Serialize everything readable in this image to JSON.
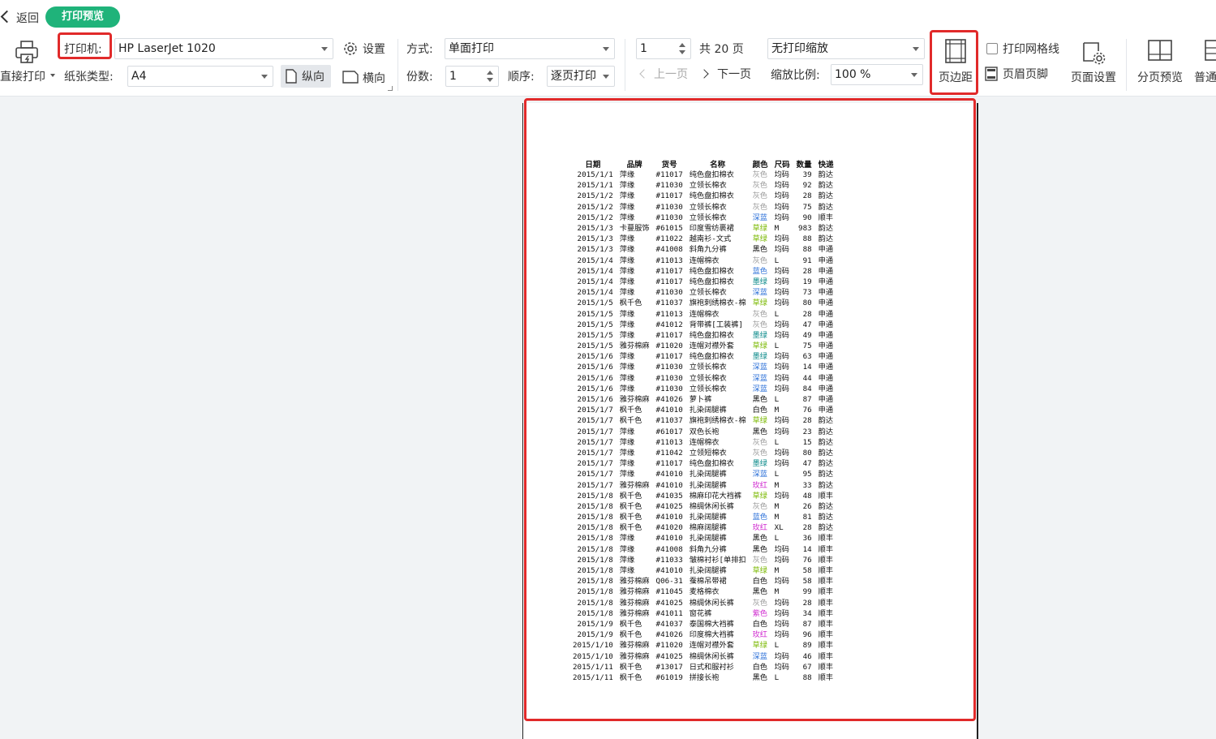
{
  "nav": {
    "back_label": "返回",
    "badge_label": "打印预览"
  },
  "toolbar": {
    "direct_print_label": "直接打印",
    "printer_label": "打印机:",
    "printer_value": "HP LaserJet 1020",
    "settings_label": "设置",
    "paper_type_label": "纸张类型:",
    "paper_type_value": "A4",
    "portrait_label": "纵向",
    "landscape_label": "横向",
    "mode_label": "方式:",
    "mode_value": "单面打印",
    "copies_label": "份数:",
    "copies_value": "1",
    "order_label": "顺序:",
    "order_value": "逐页打印",
    "page_value": "1",
    "total_pages": "共 20 页",
    "prev_page": "上一页",
    "next_page": "下一页",
    "scale_mode_value": "无打印缩放",
    "scale_ratio_label": "缩放比例:",
    "scale_ratio_value": "100 %",
    "margins_label": "页边距",
    "print_grid_label": "打印网格线",
    "header_footer_label": "页眉页脚",
    "page_setup_label": "页面设置",
    "page_break_preview_label": "分页预览",
    "normal_label": "普通"
  },
  "colors": {
    "accent_green": "#1fb37a",
    "highlight_red": "#e12a2a",
    "gray": "#9a9a9a",
    "blue": "#2a6fd8",
    "yellowgreen": "#7ab800",
    "teal": "#0a8a8a",
    "magenta": "#d02ad0",
    "black": "#111111"
  },
  "sheet": {
    "headers": [
      "日期",
      "品牌",
      "货号",
      "名称",
      "颜色",
      "尺码",
      "数量",
      "快递"
    ],
    "rows": [
      [
        "2015/1/1",
        "萍缘",
        "#11017",
        "纯色盘扣棉衣",
        "灰色",
        "均码",
        "39",
        "韵达",
        "gray"
      ],
      [
        "2015/1/1",
        "萍缘",
        "#11030",
        "立领长棉衣",
        "灰色",
        "均码",
        "92",
        "韵达",
        "gray"
      ],
      [
        "2015/1/2",
        "萍缘",
        "#11017",
        "纯色盘扣棉衣",
        "灰色",
        "均码",
        "28",
        "韵达",
        "gray"
      ],
      [
        "2015/1/2",
        "萍缘",
        "#11030",
        "立领长棉衣",
        "灰色",
        "均码",
        "75",
        "韵达",
        "gray"
      ],
      [
        "2015/1/2",
        "萍缘",
        "#11030",
        "立领长棉衣",
        "深蓝",
        "均码",
        "90",
        "顺丰",
        "blue"
      ],
      [
        "2015/1/3",
        "卡蔓服饰",
        "#61015",
        "印度雪纺裹裙",
        "草绿",
        "M",
        "983",
        "韵达",
        "yellowgreen"
      ],
      [
        "2015/1/3",
        "萍缘",
        "#11022",
        "越南衫-文式",
        "草绿",
        "均码",
        "88",
        "韵达",
        "yellowgreen"
      ],
      [
        "2015/1/3",
        "萍缘",
        "#41008",
        "斜角九分裤",
        "黑色",
        "均码",
        "88",
        "申通",
        "black"
      ],
      [
        "2015/1/4",
        "萍缘",
        "#11013",
        "连帽棉衣",
        "灰色",
        "L",
        "91",
        "申通",
        "gray"
      ],
      [
        "2015/1/4",
        "萍缘",
        "#11017",
        "纯色盘扣棉衣",
        "蓝色",
        "均码",
        "28",
        "申通",
        "blue"
      ],
      [
        "2015/1/4",
        "萍缘",
        "#11017",
        "纯色盘扣棉衣",
        "墨绿",
        "均码",
        "19",
        "申通",
        "teal"
      ],
      [
        "2015/1/4",
        "萍缘",
        "#11030",
        "立领长棉衣",
        "深蓝",
        "均码",
        "73",
        "申通",
        "blue"
      ],
      [
        "2015/1/5",
        "枫千色",
        "#11037",
        "旗袍刺绣棉衣-棉",
        "草绿",
        "均码",
        "80",
        "申通",
        "yellowgreen"
      ],
      [
        "2015/1/5",
        "萍缘",
        "#11013",
        "连帽棉衣",
        "灰色",
        "L",
        "28",
        "申通",
        "gray"
      ],
      [
        "2015/1/5",
        "萍缘",
        "#41012",
        "背带裤[工装裤]",
        "灰色",
        "均码",
        "47",
        "申通",
        "gray"
      ],
      [
        "2015/1/5",
        "萍缘",
        "#11017",
        "纯色盘扣棉衣",
        "墨绿",
        "均码",
        "49",
        "申通",
        "teal"
      ],
      [
        "2015/1/5",
        "雅芬棉麻",
        "#11020",
        "连帽对襟外套",
        "草绿",
        "L",
        "75",
        "申通",
        "yellowgreen"
      ],
      [
        "2015/1/6",
        "萍缘",
        "#11017",
        "纯色盘扣棉衣",
        "墨绿",
        "均码",
        "63",
        "申通",
        "teal"
      ],
      [
        "2015/1/6",
        "萍缘",
        "#11030",
        "立领长棉衣",
        "深蓝",
        "均码",
        "14",
        "申通",
        "blue"
      ],
      [
        "2015/1/6",
        "萍缘",
        "#11030",
        "立领长棉衣",
        "深蓝",
        "均码",
        "44",
        "申通",
        "blue"
      ],
      [
        "2015/1/6",
        "萍缘",
        "#11030",
        "立领长棉衣",
        "深蓝",
        "均码",
        "84",
        "申通",
        "blue"
      ],
      [
        "2015/1/6",
        "雅芬棉麻",
        "#41026",
        "萝卜裤",
        "黑色",
        "L",
        "87",
        "申通",
        "black"
      ],
      [
        "2015/1/7",
        "枫千色",
        "#41010",
        "扎染阔腿裤",
        "白色",
        "M",
        "76",
        "申通",
        "black"
      ],
      [
        "2015/1/7",
        "枫千色",
        "#11037",
        "旗袍刺绣棉衣-棉",
        "草绿",
        "均码",
        "28",
        "韵达",
        "yellowgreen"
      ],
      [
        "2015/1/7",
        "萍缘",
        "#61017",
        "双色长袍",
        "黑色",
        "均码",
        "23",
        "韵达",
        "black"
      ],
      [
        "2015/1/7",
        "萍缘",
        "#11013",
        "连帽棉衣",
        "灰色",
        "L",
        "15",
        "韵达",
        "gray"
      ],
      [
        "2015/1/7",
        "萍缘",
        "#11042",
        "立领短棉衣",
        "灰色",
        "均码",
        "80",
        "韵达",
        "gray"
      ],
      [
        "2015/1/7",
        "萍缘",
        "#11017",
        "纯色盘扣棉衣",
        "墨绿",
        "均码",
        "47",
        "韵达",
        "teal"
      ],
      [
        "2015/1/7",
        "萍缘",
        "#41010",
        "扎染阔腿裤",
        "深蓝",
        "L",
        "95",
        "韵达",
        "blue"
      ],
      [
        "2015/1/7",
        "雅芬棉麻",
        "#41010",
        "扎染阔腿裤",
        "玫红",
        "M",
        "33",
        "韵达",
        "magenta"
      ],
      [
        "2015/1/8",
        "枫千色",
        "#41035",
        "棉麻印花大裆裤",
        "草绿",
        "均码",
        "48",
        "顺丰",
        "yellowgreen"
      ],
      [
        "2015/1/8",
        "枫千色",
        "#41025",
        "棉绸休闲长裤",
        "灰色",
        "M",
        "26",
        "韵达",
        "gray"
      ],
      [
        "2015/1/8",
        "枫千色",
        "#41010",
        "扎染阔腿裤",
        "蓝色",
        "M",
        "81",
        "韵达",
        "blue"
      ],
      [
        "2015/1/8",
        "枫千色",
        "#41020",
        "棉麻阔腿裤",
        "玫红",
        "XL",
        "28",
        "韵达",
        "magenta"
      ],
      [
        "2015/1/8",
        "萍缘",
        "#41010",
        "扎染阔腿裤",
        "黑色",
        "L",
        "36",
        "顺丰",
        "black"
      ],
      [
        "2015/1/8",
        "萍缘",
        "#41008",
        "斜角九分裤",
        "黑色",
        "均码",
        "14",
        "顺丰",
        "black"
      ],
      [
        "2015/1/8",
        "萍缘",
        "#11033",
        "皱棉衬衫[单排扣",
        "灰色",
        "均码",
        "76",
        "顺丰",
        "gray"
      ],
      [
        "2015/1/8",
        "萍缘",
        "#41010",
        "扎染阔腿裤",
        "草绿",
        "M",
        "58",
        "顺丰",
        "yellowgreen"
      ],
      [
        "2015/1/8",
        "雅芬棉麻",
        "Q06-31",
        "蚕棉吊带裙",
        "白色",
        "均码",
        "58",
        "顺丰",
        "black"
      ],
      [
        "2015/1/8",
        "雅芬棉麻",
        "#11045",
        "麦格棉衣",
        "黑色",
        "M",
        "99",
        "顺丰",
        "black"
      ],
      [
        "2015/1/8",
        "雅芬棉麻",
        "#41025",
        "棉绸休闲长裤",
        "灰色",
        "均码",
        "28",
        "顺丰",
        "gray"
      ],
      [
        "2015/1/8",
        "雅芬棉麻",
        "#41011",
        "窗花裤",
        "紫色",
        "均码",
        "34",
        "顺丰",
        "magenta"
      ],
      [
        "2015/1/9",
        "枫千色",
        "#41037",
        "泰国棉大裆裤",
        "白色",
        "均码",
        "87",
        "顺丰",
        "black"
      ],
      [
        "2015/1/9",
        "枫千色",
        "#41026",
        "印度棉大裆裤",
        "玫红",
        "均码",
        "96",
        "顺丰",
        "magenta"
      ],
      [
        "2015/1/10",
        "雅芬棉麻",
        "#11020",
        "连帽对襟外套",
        "草绿",
        "L",
        "89",
        "顺丰",
        "yellowgreen"
      ],
      [
        "2015/1/10",
        "雅芬棉麻",
        "#41025",
        "棉绸休闲长裤",
        "深蓝",
        "均码",
        "46",
        "顺丰",
        "blue"
      ],
      [
        "2015/1/11",
        "枫千色",
        "#13017",
        "日式和服衬衫",
        "白色",
        "均码",
        "67",
        "顺丰",
        "black"
      ],
      [
        "2015/1/11",
        "枫千色",
        "#61019",
        "拼接长袍",
        "黑色",
        "L",
        "88",
        "顺丰",
        "black"
      ]
    ]
  }
}
